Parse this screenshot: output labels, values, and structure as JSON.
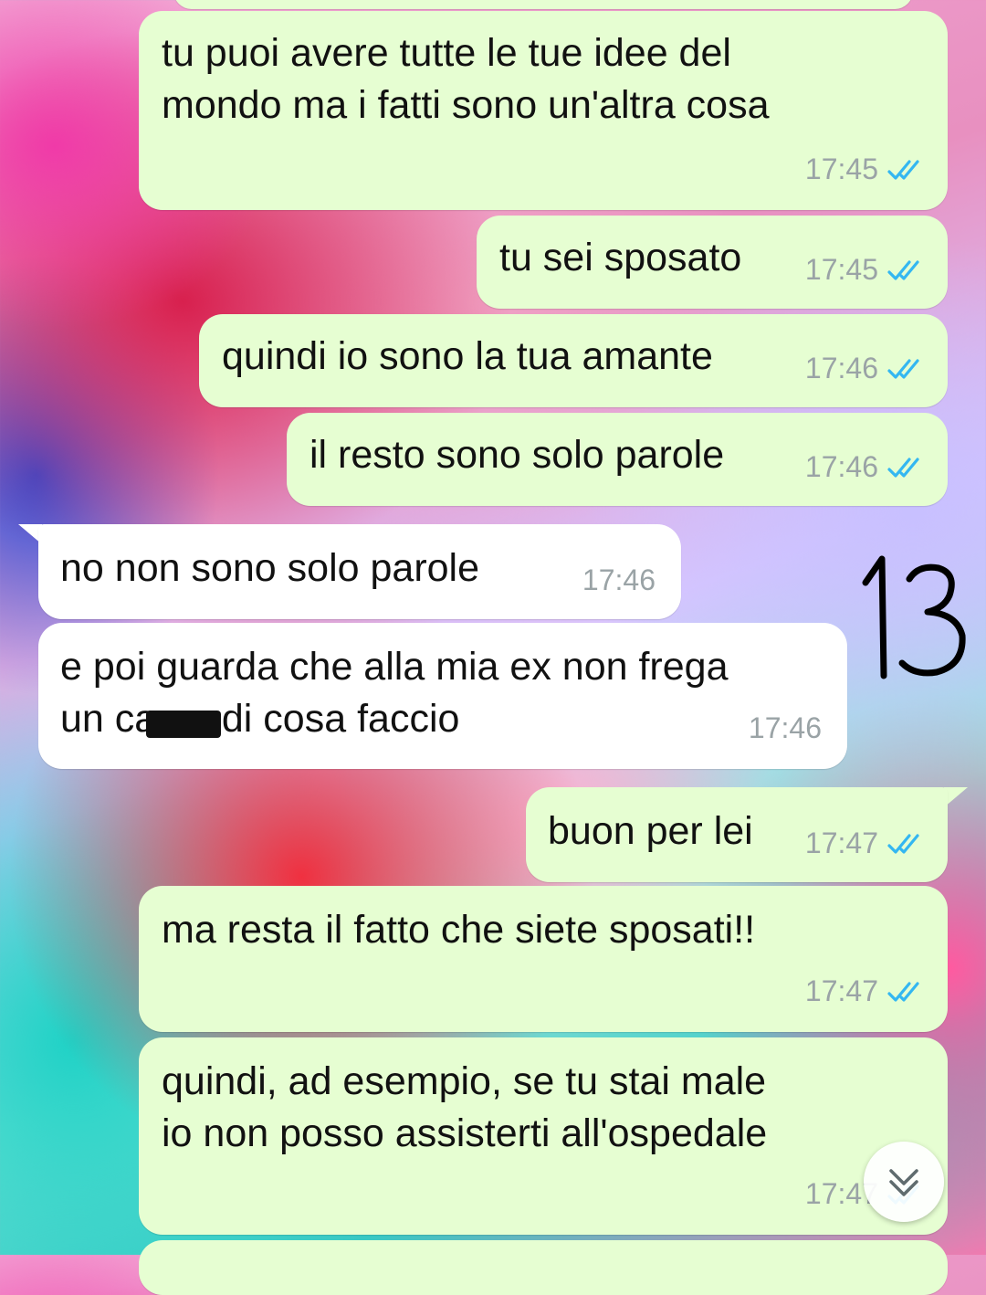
{
  "messages": [
    {
      "text": "tu puoi avere tutte le tue idee del\nmondo ma i fatti sono un'altra cosa",
      "time": "17:45"
    },
    {
      "text": "tu sei sposato",
      "time": "17:45"
    },
    {
      "text": "quindi io sono la tua amante",
      "time": "17:46"
    },
    {
      "text": "il resto sono solo parole",
      "time": "17:46"
    },
    {
      "text": "no non sono solo parole",
      "time": "17:46"
    },
    {
      "text": "e poi guarda che alla mia ex non frega\nun ca   o di cosa faccio",
      "time": "17:46"
    },
    {
      "text": "buon per lei",
      "time": "17:47"
    },
    {
      "text": "ma resta il fatto che siete sposati!!",
      "time": "17:47"
    },
    {
      "text": "quindi, ad esempio, se tu stai male\nio non posso assisterti all'ospedale",
      "time": "17:47"
    }
  ],
  "annotation": {
    "number": "13"
  },
  "icons": {
    "read_receipt": "double-check-icon",
    "scroll": "chevron-double-down-icon"
  },
  "colors": {
    "outgoing": "#e6fed2",
    "incoming": "#ffffff",
    "read_tick": "#34b7f1",
    "time_text": "#9aa3a6"
  }
}
